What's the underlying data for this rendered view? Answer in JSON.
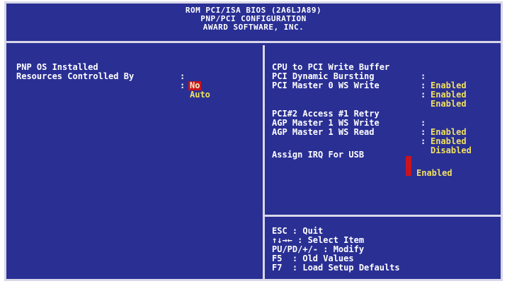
{
  "header": {
    "line1": "ROM PCI/ISA BIOS (2A6LJA89)",
    "line2": "PNP/PCI CONFIGURATION",
    "line3": "AWARD SOFTWARE, INC."
  },
  "left_items": [
    {
      "label": "PNP OS Installed",
      "value": "No",
      "selected": true
    },
    {
      "label": "Resources Controlled By",
      "value": "Auto",
      "selected": false
    }
  ],
  "right_items": [
    {
      "label": "CPU to PCI Write Buffer",
      "value": "Enabled"
    },
    {
      "label": "PCI Dynamic Bursting",
      "value": "Enabled"
    },
    {
      "label": "PCI Master 0 WS Write",
      "value": "Enabled"
    },
    {
      "label": "PCI#2 Access #1 Retry",
      "value": "Enabled"
    },
    {
      "label": "AGP Master 1 WS Write",
      "value": "Enabled"
    },
    {
      "label": "AGP Master 1 WS Read",
      "value": "Disabled"
    },
    {
      "label": "Assign IRQ For USB",
      "value": "Enabled"
    }
  ],
  "separator": ":",
  "help": [
    "ESC : Quit",
    "↑↓→← : Select Item",
    "PU/PD/+/- : Modify",
    "F5  : Old Values",
    "F7  : Load Setup Defaults"
  ],
  "colors": {
    "background": "#2a2f94",
    "value": "#f0e060",
    "highlight": "#c8141e",
    "border": "#d8d8e8"
  }
}
